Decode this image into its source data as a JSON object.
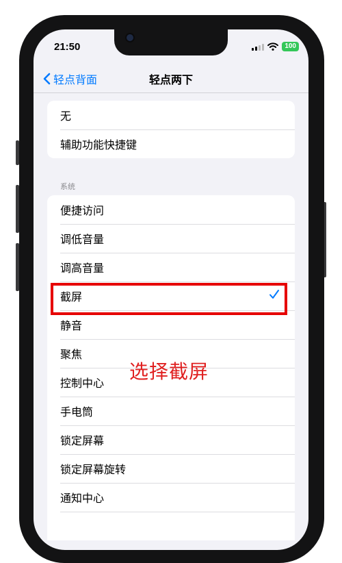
{
  "status": {
    "time": "21:50",
    "battery": "100"
  },
  "nav": {
    "back_label": "轻点背面",
    "title": "轻点两下"
  },
  "top_group": [
    "无",
    "辅助功能快捷键"
  ],
  "section_header": "系统",
  "system_group": [
    {
      "label": "便捷访问"
    },
    {
      "label": "调低音量"
    },
    {
      "label": "调高音量"
    },
    {
      "label": "截屏",
      "selected": true
    },
    {
      "label": "静音"
    },
    {
      "label": "聚焦"
    },
    {
      "label": "控制中心"
    },
    {
      "label": "手电筒"
    },
    {
      "label": "锁定屏幕"
    },
    {
      "label": "锁定屏幕旋转"
    },
    {
      "label": "通知中心"
    }
  ],
  "annotation": {
    "text": "选择截屏",
    "color": "#e02020"
  },
  "colors": {
    "accent": "#007aff",
    "highlight_box": "#e60000",
    "background": "#f2f2f7"
  },
  "icons": {
    "back": "chevron-left-icon",
    "check": "checkmark-icon",
    "wifi": "wifi-icon",
    "signal": "cellular-signal-icon"
  }
}
